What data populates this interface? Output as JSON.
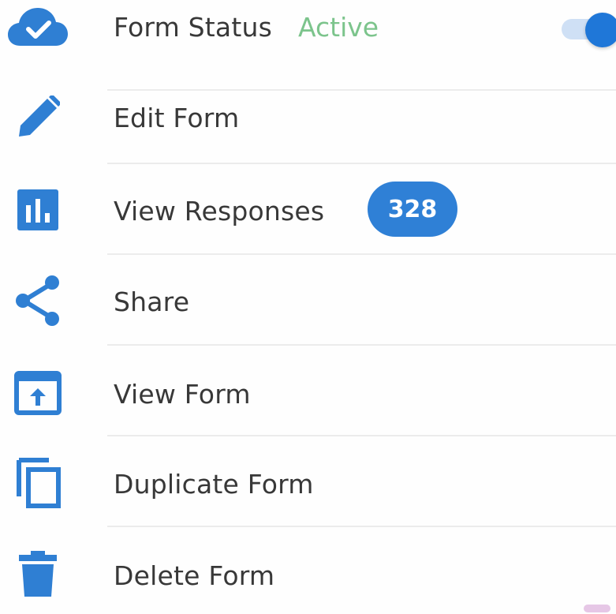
{
  "colors": {
    "accent": "#2f80d6",
    "status_active": "#7cc48c",
    "text": "#383838"
  },
  "menu": {
    "status_row": {
      "label": "Form Status",
      "status": "Active",
      "icon": "cloud-check-icon",
      "toggle_on": true
    },
    "items": [
      {
        "label": "Edit Form",
        "icon": "pencil-icon"
      },
      {
        "label": "View Responses",
        "icon": "bar-chart-icon",
        "badge": "328"
      },
      {
        "label": "Share",
        "icon": "share-icon"
      },
      {
        "label": "View Form",
        "icon": "open-in-window-icon"
      },
      {
        "label": "Duplicate Form",
        "icon": "copy-icon"
      },
      {
        "label": "Delete Form",
        "icon": "trash-icon"
      }
    ]
  }
}
